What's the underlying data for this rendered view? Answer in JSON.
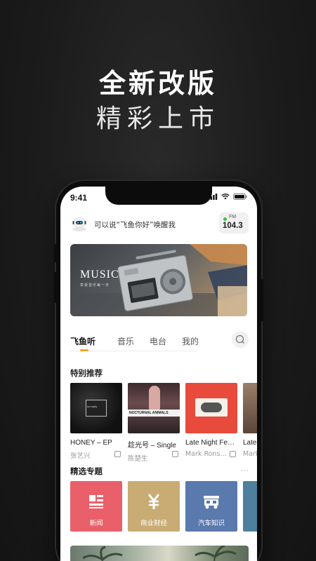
{
  "promo": {
    "headline": "全新改版",
    "subline": "精彩上市"
  },
  "status_bar": {
    "time": "9:41"
  },
  "voice": {
    "prompt": "可以说“飞鱼你好”唤醒我"
  },
  "fm": {
    "label": "FM",
    "frequency": "104.3"
  },
  "banner": {
    "title": "MUSIC",
    "subtitle": "享受音乐每一天"
  },
  "tabs": [
    {
      "label": "飞鱼听",
      "active": true
    },
    {
      "label": "音乐",
      "active": false
    },
    {
      "label": "电台",
      "active": false
    },
    {
      "label": "我的",
      "active": false
    }
  ],
  "featured": {
    "title": "特别推荐",
    "items": [
      {
        "title": "HONEY – EP",
        "artist": "张艺兴",
        "cover_text": "no reply"
      },
      {
        "title": "趁光号 – Single",
        "artist": "陈楚生",
        "cover_text": "NOCTURNAL ANIMALS"
      },
      {
        "title": "Late Night Fe…",
        "artist": "Mark Rons…",
        "cover_text": ""
      },
      {
        "title": "Late",
        "artist": "Mark",
        "cover_text": ""
      }
    ]
  },
  "topics": {
    "title": "精选专题",
    "more": "···",
    "items": [
      {
        "label": "新闻",
        "icon": "news-icon",
        "color": "#e9606a"
      },
      {
        "label": "商业财经",
        "icon": "yuan-icon",
        "color": "#c8ac74"
      },
      {
        "label": "汽车知识",
        "icon": "car-icon",
        "color": "#5a79ad"
      },
      {
        "label": "",
        "icon": "",
        "color": "#4e7f9e"
      }
    ]
  },
  "colors": {
    "accent": "#f5a623",
    "fm_dot": "#3fbf4a"
  }
}
